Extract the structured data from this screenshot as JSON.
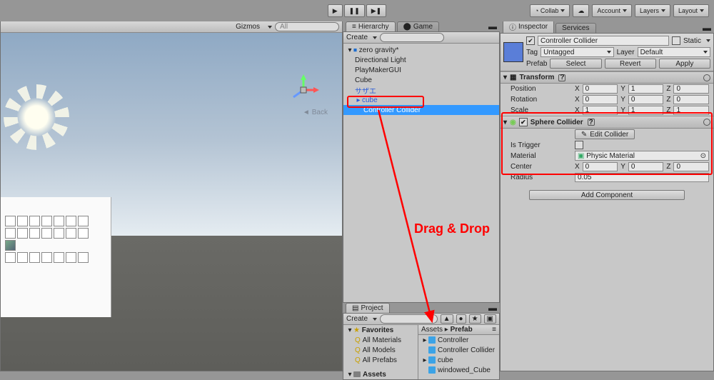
{
  "toolbar": {
    "collab_label": "Collab",
    "account_label": "Account",
    "layers_label": "Layers",
    "layout_label": "Layout"
  },
  "scene": {
    "gizmos_label": "Gizmos",
    "all_label": "All",
    "back_label": "Back"
  },
  "hierarchy": {
    "tab": "Hierarchy",
    "game_tab": "Game",
    "create_label": "Create",
    "root": "zero gravity*",
    "items": [
      "Directional Light",
      "PlayMakerGUI",
      "Cube",
      "サザエ",
      "cube"
    ],
    "selected": "Controller Collider"
  },
  "project": {
    "tab": "Project",
    "create_label": "Create",
    "favorites_label": "Favorites",
    "favorites": [
      "All Materials",
      "All Models",
      "All Prefabs"
    ],
    "assets_label": "Assets",
    "breadcrumb_root": "Assets",
    "breadcrumb_current": "Prefab",
    "prefabs": [
      "Controller",
      "Controller Collider",
      "cube",
      "windowed_Cube"
    ]
  },
  "inspector": {
    "tab": "Inspector",
    "services_tab": "Services",
    "name": "Controller Collider",
    "static_label": "Static",
    "tag_label": "Tag",
    "tag_value": "Untagged",
    "layer_label": "Layer",
    "layer_value": "Default",
    "prefab_label": "Prefab",
    "select_btn": "Select",
    "revert_btn": "Revert",
    "apply_btn": "Apply",
    "transform": {
      "title": "Transform",
      "position_label": "Position",
      "rotation_label": "Rotation",
      "scale_label": "Scale",
      "pos": {
        "x": "0",
        "y": "1",
        "z": "0"
      },
      "rot": {
        "x": "0",
        "y": "0",
        "z": "0"
      },
      "scl": {
        "x": "1",
        "y": "1",
        "z": "1"
      }
    },
    "sphere": {
      "title": "Sphere Collider",
      "edit_label": "Edit Collider",
      "trigger_label": "Is Trigger",
      "material_label": "Material",
      "material_value": "Physic Material",
      "center_label": "Center",
      "radius_label": "Radius",
      "center": {
        "x": "0",
        "y": "0",
        "z": "0"
      },
      "radius": "0.05"
    },
    "add_component": "Add Component"
  },
  "annotation": {
    "drag_drop": "Drag & Drop"
  }
}
